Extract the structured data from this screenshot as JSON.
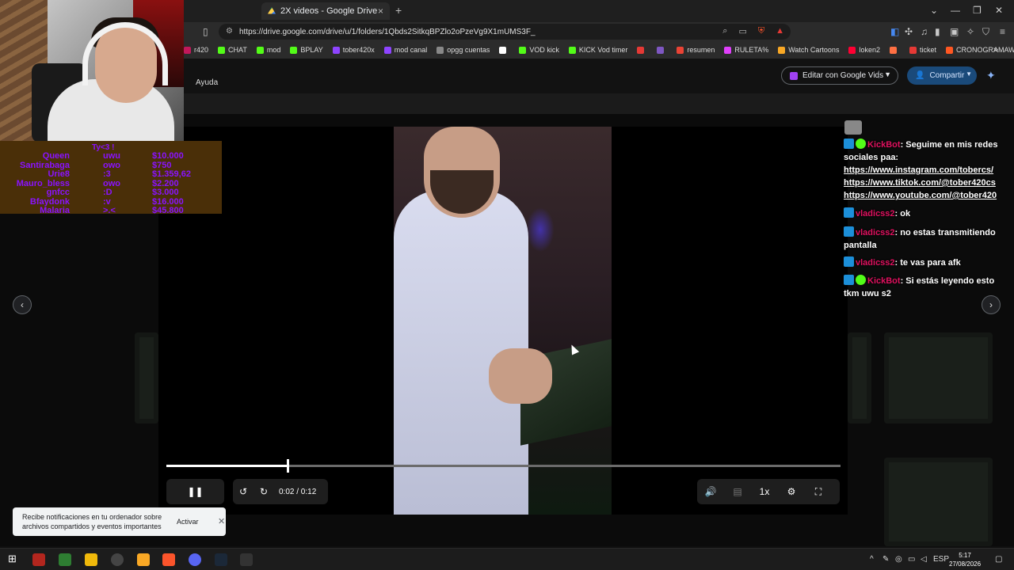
{
  "browser": {
    "tab_title": "2X videos - Google Drive",
    "tab_close": "×",
    "new_tab": "+",
    "url": "https://drive.google.com/drive/u/1/folders/1Qbds2SitkqBPZlo2oPzeVg9X1mUMS3F_",
    "win_minimize": "—",
    "win_restore": "❐",
    "win_close": "✕",
    "win_dropdown": "⌄"
  },
  "bookmarks": [
    {
      "label": "r420",
      "color": "#c2185b"
    },
    {
      "label": "CHAT",
      "color": "#53fc18"
    },
    {
      "label": "mod",
      "color": "#53fc18"
    },
    {
      "label": "BPLAY",
      "color": "#53fc18"
    },
    {
      "label": "tober420x",
      "color": "#8e44ff"
    },
    {
      "label": "mod canal",
      "color": "#8e44ff"
    },
    {
      "label": "opgg cuentas",
      "color": "#888888"
    },
    {
      "label": "",
      "color": "#ffffff"
    },
    {
      "label": "VOD kick",
      "color": "#53fc18"
    },
    {
      "label": "KICK Vod timer",
      "color": "#53fc18"
    },
    {
      "label": "",
      "color": "#e53935"
    },
    {
      "label": "",
      "color": "#7e57c2"
    },
    {
      "label": "resumen",
      "color": "#ea4335"
    },
    {
      "label": "RULETA%",
      "color": "#e040fb"
    },
    {
      "label": "Watch Cartoons",
      "color": "#f9a825"
    },
    {
      "label": "loken2",
      "color": "#ff0033"
    },
    {
      "label": "",
      "color": "#ff7043"
    },
    {
      "label": "ticket",
      "color": "#e53935"
    },
    {
      "label": "CRONOGRAMAWO...",
      "color": "#ff5722"
    }
  ],
  "drive": {
    "help": "Ayuda",
    "edit_vids": "Editar con Google Vids",
    "share": "Compartir"
  },
  "player": {
    "time": "0:02 / 0:12",
    "progress": 0.18,
    "speed": "1x"
  },
  "tips": {
    "title": "Ty<3 !",
    "rows": [
      {
        "name": "Queen",
        "emote": "uwu",
        "amount": "$10.000"
      },
      {
        "name": "Santirabaga",
        "emote": "owo",
        "amount": "$750"
      },
      {
        "name": "Urie8",
        "emote": ":3",
        "amount": "$1.359,62"
      },
      {
        "name": "Mauro_bless",
        "emote": "owo",
        "amount": "$2.200"
      },
      {
        "name": "gnfcc",
        "emote": ":D",
        "amount": "$3.000"
      },
      {
        "name": "Bfaydonk",
        "emote": ":v",
        "amount": "$16.000"
      },
      {
        "name": "Malaria",
        "emote": ">.<",
        "amount": "$45.800"
      }
    ]
  },
  "chat": [
    {
      "user": "KickBot",
      "verified": true,
      "text": ": Seguime en mis redes sociales paa:",
      "links": [
        "https://www.instagram.com/tobercs/",
        "https://www.tiktok.com/@tober420cs",
        "https://www.youtube.com/@tober420"
      ]
    },
    {
      "user": "vladicss2",
      "verified": false,
      "text": ": ok",
      "links": []
    },
    {
      "user": "vladicss2",
      "verified": false,
      "text": ": no estas transmitiendo pantalla",
      "links": []
    },
    {
      "user": "vladicss2",
      "verified": false,
      "text": ": te vas para afk",
      "links": []
    },
    {
      "user": "KickBot",
      "verified": true,
      "text": ": Si estás leyendo esto tkm uwu s2",
      "links": []
    }
  ],
  "toast": {
    "text": "Recibe notificaciones en tu ordenador sobre archivos compartidos y eventos importantes",
    "action": "Activar",
    "close": "✕"
  },
  "taskbar": {
    "lang": "ESP",
    "time": "5:17",
    "date": "27/08/2026"
  }
}
